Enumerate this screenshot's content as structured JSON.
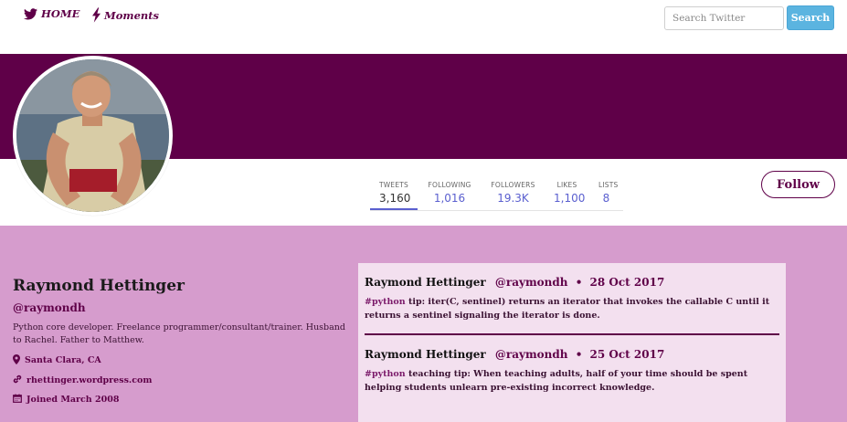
{
  "nav": {
    "home_label": "HOME",
    "moments_label": "Moments",
    "search_placeholder": "Search Twitter",
    "search_button": "Search"
  },
  "colors": {
    "brand": "#5f0048",
    "content_bg": "#d69ccd",
    "feed_bg": "#f3e0ef",
    "stat_link": "#5a5fcf",
    "search_button": "#5bb4e0"
  },
  "stats": [
    {
      "label": "TWEETS",
      "value": "3,160"
    },
    {
      "label": "FOLLOWING",
      "value": "1,016"
    },
    {
      "label": "FOLLOWERS",
      "value": "19.3K"
    },
    {
      "label": "LIKES",
      "value": "1,100"
    },
    {
      "label": "LISTS",
      "value": "8"
    }
  ],
  "follow_label": "Follow",
  "profile": {
    "name": "Raymond Hettinger",
    "handle": "@raymondh",
    "bio": "Python core developer. Freelance programmer/consultant/trainer. Husband to Rachel. Father to Matthew.",
    "location": "Santa Clara, CA",
    "website": "rhettinger.wordpress.com",
    "joined": "Joined March 2008"
  },
  "tweets": [
    {
      "name": "Raymond Hettinger",
      "handle": "@raymondh",
      "dot": "•",
      "date": "28 Oct 2017",
      "hashtag": "#python",
      "text": " tip: iter(C, sentinel) returns an iterator that invokes the callable C until it returns a sentinel signaling the iterator is done."
    },
    {
      "name": "Raymond Hettinger",
      "handle": "@raymondh",
      "dot": "•",
      "date": "25 Oct 2017",
      "hashtag": "#python",
      "text": " teaching tip: When teaching adults, half of your time should be spent helping students unlearn pre-existing incorrect knowledge."
    }
  ]
}
